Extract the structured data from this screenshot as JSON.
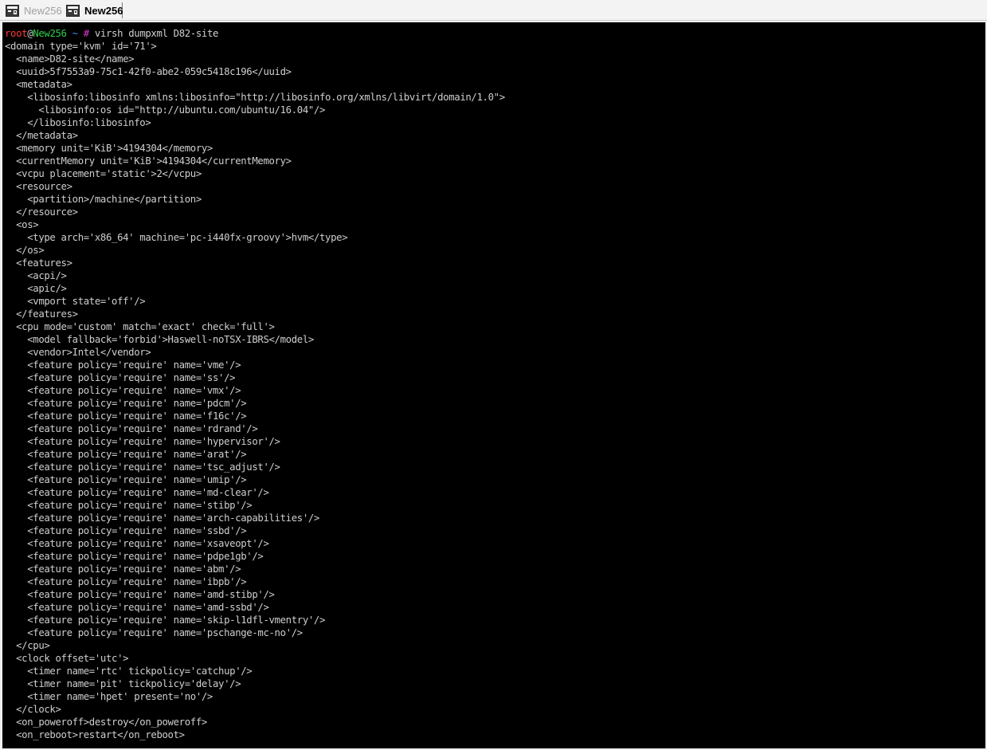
{
  "tabs": [
    {
      "label": "New256",
      "active": false,
      "icon": "terminal-icon"
    },
    {
      "label": "New256",
      "active": true,
      "icon": "terminal-icon"
    }
  ],
  "prompt": {
    "user": "root",
    "at": "@",
    "host": "New256",
    "path": " ~ ",
    "symbol": "#",
    "command": " virsh dumpxml D82-site"
  },
  "colors": {
    "user": "#ff3a3a",
    "host": "#2ecf4a",
    "path": "#4a8cff",
    "symbol": "#d43bd4",
    "text": "#cfcfcf",
    "background": "#000000"
  },
  "output_lines": [
    "<domain type='kvm' id='71'>",
    "  <name>D82-site</name>",
    "  <uuid>5f7553a9-75c1-42f0-abe2-059c5418c196</uuid>",
    "  <metadata>",
    "    <libosinfo:libosinfo xmlns:libosinfo=\"http://libosinfo.org/xmlns/libvirt/domain/1.0\">",
    "      <libosinfo:os id=\"http://ubuntu.com/ubuntu/16.04\"/>",
    "    </libosinfo:libosinfo>",
    "  </metadata>",
    "  <memory unit='KiB'>4194304</memory>",
    "  <currentMemory unit='KiB'>4194304</currentMemory>",
    "  <vcpu placement='static'>2</vcpu>",
    "  <resource>",
    "    <partition>/machine</partition>",
    "  </resource>",
    "  <os>",
    "    <type arch='x86_64' machine='pc-i440fx-groovy'>hvm</type>",
    "  </os>",
    "  <features>",
    "    <acpi/>",
    "    <apic/>",
    "    <vmport state='off'/>",
    "  </features>",
    "  <cpu mode='custom' match='exact' check='full'>",
    "    <model fallback='forbid'>Haswell-noTSX-IBRS</model>",
    "    <vendor>Intel</vendor>",
    "    <feature policy='require' name='vme'/>",
    "    <feature policy='require' name='ss'/>",
    "    <feature policy='require' name='vmx'/>",
    "    <feature policy='require' name='pdcm'/>",
    "    <feature policy='require' name='f16c'/>",
    "    <feature policy='require' name='rdrand'/>",
    "    <feature policy='require' name='hypervisor'/>",
    "    <feature policy='require' name='arat'/>",
    "    <feature policy='require' name='tsc_adjust'/>",
    "    <feature policy='require' name='umip'/>",
    "    <feature policy='require' name='md-clear'/>",
    "    <feature policy='require' name='stibp'/>",
    "    <feature policy='require' name='arch-capabilities'/>",
    "    <feature policy='require' name='ssbd'/>",
    "    <feature policy='require' name='xsaveopt'/>",
    "    <feature policy='require' name='pdpe1gb'/>",
    "    <feature policy='require' name='abm'/>",
    "    <feature policy='require' name='ibpb'/>",
    "    <feature policy='require' name='amd-stibp'/>",
    "    <feature policy='require' name='amd-ssbd'/>",
    "    <feature policy='require' name='skip-l1dfl-vmentry'/>",
    "    <feature policy='require' name='pschange-mc-no'/>",
    "  </cpu>",
    "  <clock offset='utc'>",
    "    <timer name='rtc' tickpolicy='catchup'/>",
    "    <timer name='pit' tickpolicy='delay'/>",
    "    <timer name='hpet' present='no'/>",
    "  </clock>",
    "  <on_poweroff>destroy</on_poweroff>",
    "  <on_reboot>restart</on_reboot>"
  ]
}
